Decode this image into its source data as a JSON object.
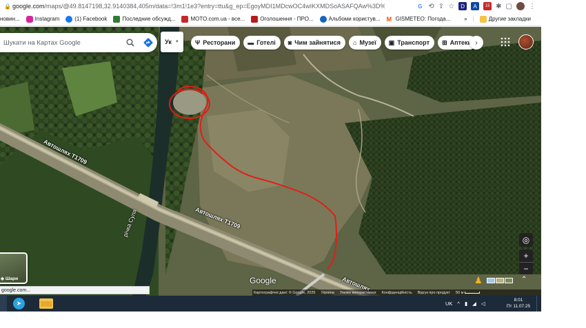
{
  "browser": {
    "url_host": "google.com",
    "url_rest": "/maps/@49.8147198,32.9140384,405m/data=!3m1!1e3?entry=ttu&g_ep=EgoyMDI1MDcwOC4wIKXMDSoASAFQAw%3D%3D",
    "extension_letters": [
      "G",
      "D",
      "A"
    ],
    "badge_count": "15"
  },
  "bookmarks": {
    "items": [
      {
        "label": "новин...",
        "color": "#cccccc"
      },
      {
        "label": "Instagram",
        "color": "#d6249f"
      },
      {
        "label": "(1) Facebook",
        "color": "#1877f2"
      },
      {
        "label": "Последние обсужд...",
        "color": "#2e7d32"
      },
      {
        "label": "MOTO.com.ua - все...",
        "color": "#c62828"
      },
      {
        "label": "Оголошення - ПРО...",
        "color": "#b71c1c"
      },
      {
        "label": "Альбоми користув...",
        "color": "#1565c0"
      },
      {
        "label": "GISMETEO: Погода...",
        "color": "#e65100"
      }
    ],
    "overflow": "»",
    "other_bookmarks": "Другие закладки"
  },
  "map": {
    "search_placeholder": "Шукати на Картах Google",
    "lang_button": "Ук",
    "chips": [
      {
        "icon": "restaurant-icon",
        "glyph": "🍴",
        "label": "Ресторани"
      },
      {
        "icon": "hotel-icon",
        "glyph": "🛏",
        "label": "Готелі"
      },
      {
        "icon": "camera-icon",
        "glyph": "📷",
        "label": "Чим зайнятися"
      },
      {
        "icon": "museum-icon",
        "glyph": "🏛",
        "label": "Музеї"
      },
      {
        "icon": "transit-icon",
        "glyph": "🚆",
        "label": "Транспорт"
      },
      {
        "icon": "pharmacy-icon",
        "glyph": "💊",
        "label": "Аптеки"
      }
    ],
    "road_labels": [
      "Автошлях Т1709",
      "Автошлях Т1709",
      "Автошлях"
    ],
    "river_label": "річка Сула",
    "layers_label": "Шари",
    "google_logo": "Google",
    "attribution": {
      "data": "Картографічні дані: © Google, 2025",
      "country": "Україна",
      "terms": "Умови використання",
      "privacy": "Конфіденційність",
      "feedback": "Відгук про продукт",
      "scale": "50 м"
    },
    "status_url": "google.com..."
  },
  "taskbar": {
    "lang": "UK",
    "time": "8:01",
    "date": "Пт 11.07.25"
  }
}
